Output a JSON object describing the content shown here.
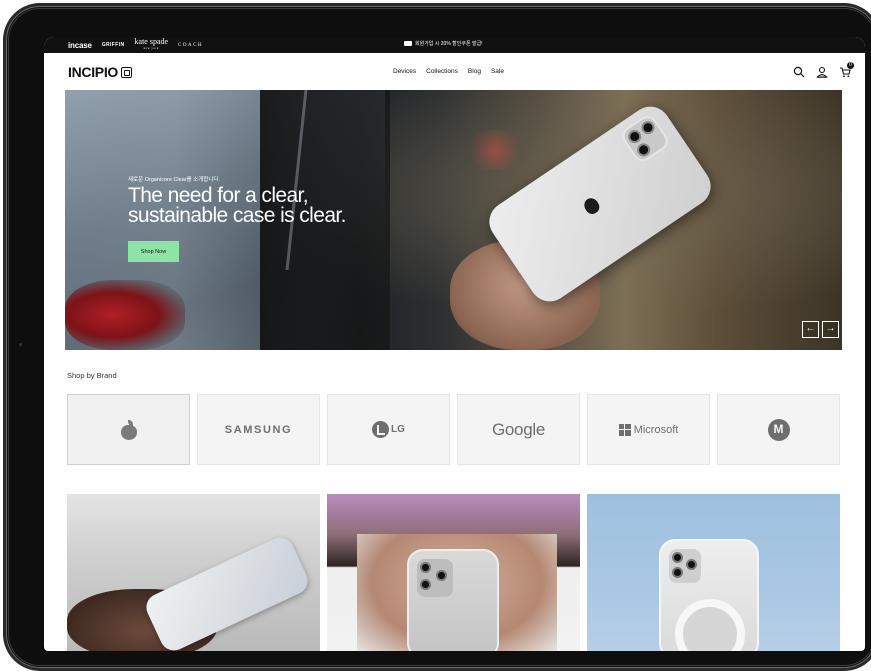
{
  "top_bar": {
    "brands": [
      "incase",
      "GRIFFIN",
      "kate spade",
      "new york",
      "COACH"
    ],
    "promo_text": "회원가입 시 20% 할인쿠폰 발급!"
  },
  "header": {
    "logo": "INCIPIO",
    "nav": [
      "Devices",
      "Collections",
      "Blog",
      "Sale"
    ],
    "cart_count": "0"
  },
  "hero": {
    "eyebrow": "새로운 Organicore Clear를 소개합니다.",
    "title_line1": "The need for a clear,",
    "title_line2": "sustainable case is clear.",
    "cta": "Shop Now",
    "prev_arrow": "←",
    "next_arrow": "→"
  },
  "shop_by_brand": {
    "title": "Shop by Brand",
    "brands": [
      "Apple",
      "SAMSUNG",
      "LG",
      "Google",
      "Microsoft",
      "Motorola"
    ]
  }
}
